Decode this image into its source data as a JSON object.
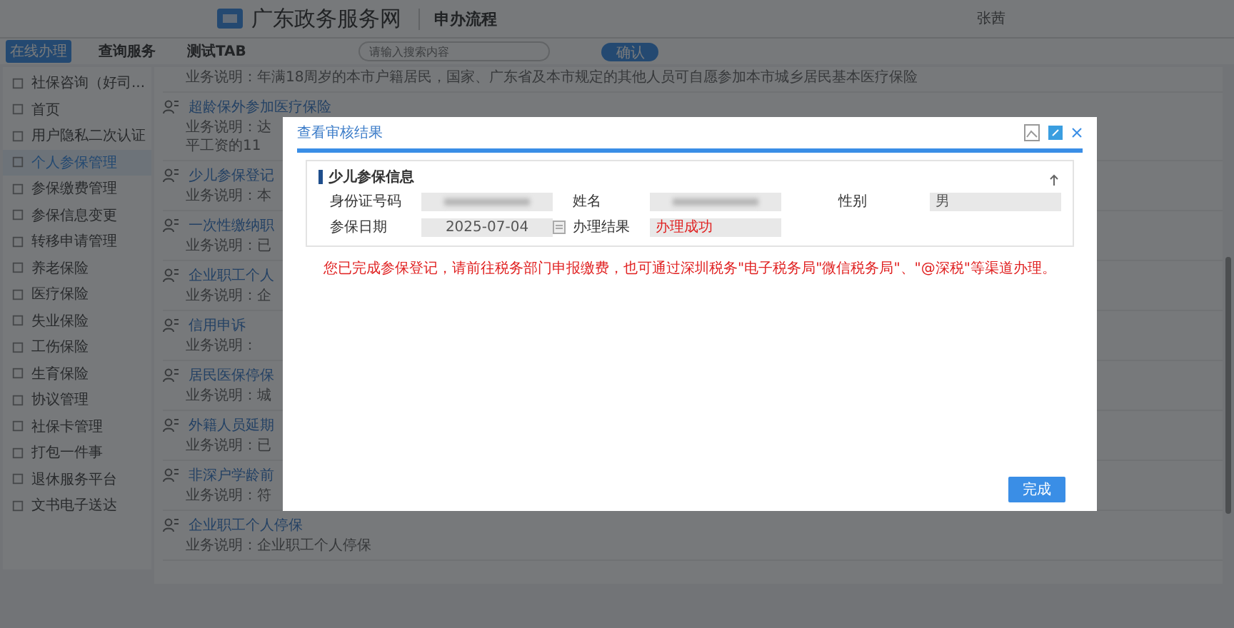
{
  "header": {
    "site_title": "广东政务服务网",
    "subtitle": "申办流程",
    "user": "张茜"
  },
  "tabs": [
    {
      "label": "在线办理",
      "selected": true
    },
    {
      "label": "查询服务",
      "selected": false
    },
    {
      "label": "测试TAB",
      "selected": false
    }
  ],
  "search": {
    "placeholder": "请输入搜索内容",
    "button": "确认"
  },
  "sidebar": {
    "items": [
      {
        "label": "社保咨询（好司...",
        "selected": false
      },
      {
        "label": "首页",
        "selected": false
      },
      {
        "label": "用户隐私二次认证",
        "selected": false
      },
      {
        "label": "个人参保管理",
        "selected": true
      },
      {
        "label": "参保缴费管理",
        "selected": false
      },
      {
        "label": "参保信息变更",
        "selected": false
      },
      {
        "label": "转移申请管理",
        "selected": false
      },
      {
        "label": "养老保险",
        "selected": false
      },
      {
        "label": "医疗保险",
        "selected": false
      },
      {
        "label": "失业保险",
        "selected": false
      },
      {
        "label": "工伤保险",
        "selected": false
      },
      {
        "label": "生育保险",
        "selected": false
      },
      {
        "label": "协议管理",
        "selected": false
      },
      {
        "label": "社保卡管理",
        "selected": false
      },
      {
        "label": "打包一件事",
        "selected": false
      },
      {
        "label": "退休服务平台",
        "selected": false
      },
      {
        "label": "文书电子送达",
        "selected": false
      }
    ]
  },
  "services": [
    {
      "description": "业务说明：年满18周岁的本市户籍居民，国家、广东省及本市规定的其他人员可自愿参加本市城乡居民基本医疗保险"
    },
    {
      "title": "超龄保外参加医疗保险",
      "description": "业务说明：达",
      "description_2": "平工资的11"
    },
    {
      "title": "少儿参保登记",
      "description": "业务说明：本"
    },
    {
      "title": "一次性缴纳职",
      "description": "业务说明：已"
    },
    {
      "title": "企业职工个人",
      "description": "业务说明：企"
    },
    {
      "title": "信用申诉",
      "description": "业务说明："
    },
    {
      "title": "居民医保停保",
      "description": "业务说明：城"
    },
    {
      "title": "外籍人员延期",
      "description": "业务说明：已"
    },
    {
      "title": "非深户学龄前",
      "description": "业务说明：符"
    },
    {
      "title": "企业职工个人停保",
      "description": "业务说明：企业职工个人停保"
    }
  ],
  "dialog": {
    "title": "查看审核结果",
    "section": "少儿参保信息",
    "fields": [
      {
        "label": "身份证号码",
        "kind": "redacted"
      },
      {
        "label": "姓名",
        "kind": "redacted"
      },
      {
        "label": "性别",
        "kind": "text",
        "value": "男"
      },
      {
        "label": "参保日期",
        "kind": "date",
        "value": "2025-07-04"
      },
      {
        "label": "办理结果",
        "kind": "status",
        "value": "办理成功"
      }
    ],
    "message": "您已完成参保登记，请前往税务部门申报缴费，也可通过深圳税务\"电子税务局\"微信税务局\"、\"@深税\"等渠道办理。",
    "button": "完成"
  }
}
